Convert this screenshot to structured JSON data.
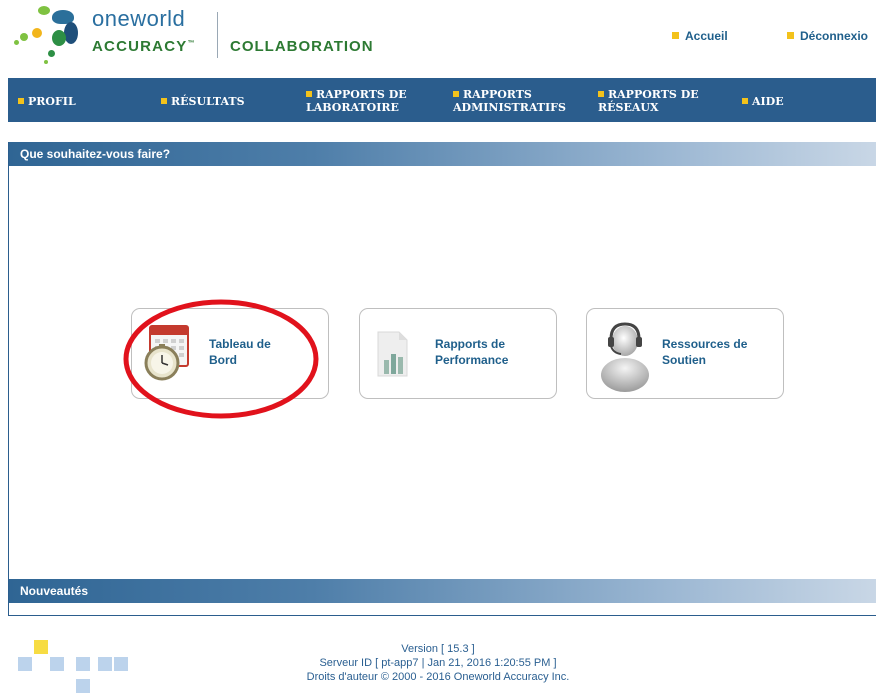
{
  "header": {
    "brand_top": "oneworld",
    "brand_accuracy": "ACCURACY",
    "brand_tm": "™",
    "brand_collaboration": "COLLABORATION",
    "links": [
      {
        "label": "Accueil"
      },
      {
        "label": "Déconnexio"
      }
    ]
  },
  "nav": {
    "items": [
      {
        "label": "PROFIL"
      },
      {
        "label": "RÉSULTATS"
      },
      {
        "line1": "RAPPORTS DE",
        "line2": "LABORATOIRE"
      },
      {
        "line1": "RAPPORTS",
        "line2": "ADMINISTRATIFS"
      },
      {
        "line1": "RAPPORTS DE",
        "line2": "RÉSEAUX"
      },
      {
        "label": "AIDE"
      }
    ]
  },
  "main": {
    "question_title": "Que souhaitez-vous faire?",
    "cards": [
      {
        "line1": "Tableau de",
        "line2": "Bord",
        "icon": "calendar-clock-icon"
      },
      {
        "line1": "Rapports de",
        "line2": "Performance",
        "icon": "report-chart-icon"
      },
      {
        "line1": "Ressources de",
        "line2": "Soutien",
        "icon": "support-headset-icon"
      }
    ],
    "news_title": "Nouveautés"
  },
  "annotation": {
    "color": "#e1121c"
  },
  "footer": {
    "version": "Version [ 15.3 ]",
    "server": "Serveur ID [ pt-app7 | Jan 21, 2016 1:20:55 PM ]",
    "copyright": "Droits d'auteur © 2000 - 2016 Oneworld Accuracy Inc."
  },
  "colors": {
    "nav_bg": "#2b5d8d",
    "accent": "#f3c21b",
    "link": "#1f5f8b",
    "brand_green": "#2d7a33"
  }
}
